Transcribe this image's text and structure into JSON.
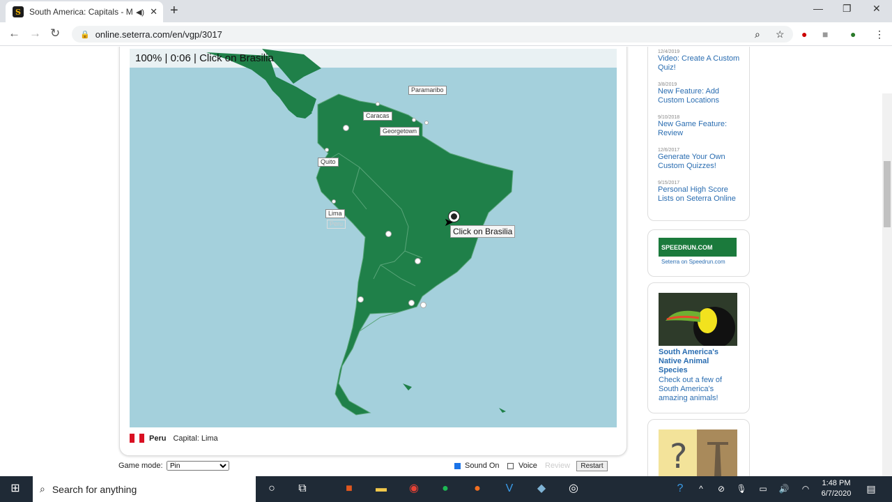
{
  "browser": {
    "tab_title": "South America: Capitals - Ma",
    "url": "online.seterra.com/en/vgp/3017",
    "new_tab": "+"
  },
  "game": {
    "score": "100%",
    "time": "0:06",
    "prompt": "Click on Brasilia",
    "sep": "|",
    "labels": {
      "paramaribo": "Paramaribo",
      "caracas": "Caracas",
      "georgetown": "Georgetown",
      "quito": "Quito",
      "lima": "Lima",
      "peru": "Peru"
    },
    "tooltip": "Click on Brasilia",
    "footer_country": "Peru",
    "footer_capital": "Capital: Lima"
  },
  "controls": {
    "mode_label": "Game mode:",
    "mode_value": "Pin",
    "sound": "Sound On",
    "voice": "Voice",
    "review": "Review",
    "restart": "Restart"
  },
  "sidebar": {
    "news": [
      {
        "date": "12/4/2019",
        "title": "Video: Create A Custom Quiz!"
      },
      {
        "date": "3/8/2019",
        "title": "New Feature: Add Custom Locations"
      },
      {
        "date": "9/10/2018",
        "title": "New Game Feature: Review"
      },
      {
        "date": "12/6/2017",
        "title": "Generate Your Own Custom Quizzes!"
      },
      {
        "date": "9/15/2017",
        "title": "Personal High Score Lists on Seterra Online"
      }
    ],
    "speedrun_logo": "SPEEDRUN.COM",
    "speedrun_caption": "Seterra on Speedrun.com",
    "animals_title": "South America's Native Animal Species",
    "animals_text": "Check out a few of South America's amazing animals!"
  },
  "taskbar": {
    "search_placeholder": "Search for anything",
    "time": "1:48 PM",
    "date": "6/7/2020"
  },
  "colors": {
    "land": "#1f8049",
    "water": "#a4d0dc",
    "peru_flag_red": "#d91023"
  }
}
